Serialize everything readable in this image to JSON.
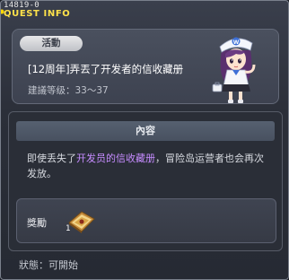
{
  "window": {
    "quest_id": "14819-0",
    "title": "QUEST INFO"
  },
  "header": {
    "status_tag": "活動",
    "quest_title": "[12周年]弄丟了开发者的信收藏册",
    "level": "建議等级：33～37"
  },
  "content": {
    "section_title": "內容",
    "description_before": "即使丢失了",
    "description_highlight": "开发员的信收藏册",
    "description_after": "，冒险岛运营者也会再次发放。"
  },
  "reward": {
    "label": "獎勵",
    "item_icon": "book-reward-icon",
    "item_count": "1"
  },
  "footer": {
    "status": "狀態：可開始"
  },
  "colors": {
    "title": "#ffe24a",
    "highlight": "#c68cff"
  }
}
